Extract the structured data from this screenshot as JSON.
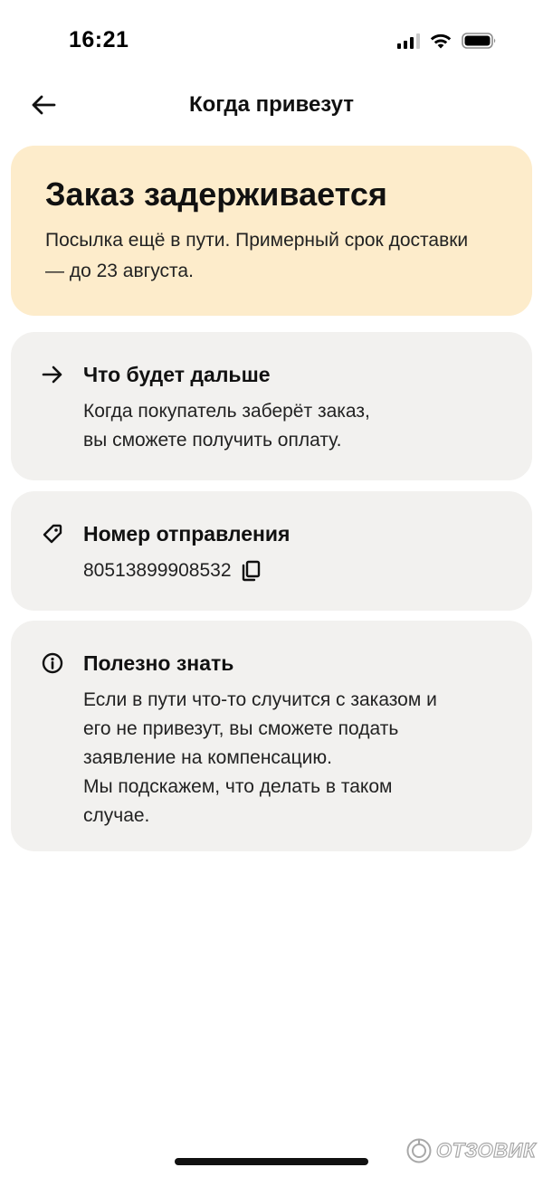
{
  "status_bar": {
    "time": "16:21",
    "icons": [
      "cellular-signal-icon",
      "wifi-icon",
      "battery-icon"
    ]
  },
  "header": {
    "title": "Когда привезут",
    "back_icon": "arrow-left-icon"
  },
  "alert": {
    "title": "Заказ задерживается",
    "text": "Посылка ещё в пути. Примерный срок доставки — до 23 августа.",
    "background_color": "#fdeccb"
  },
  "cards": {
    "next": {
      "icon": "arrow-right-icon",
      "title": "Что будет дальше",
      "lines": [
        "Когда покупатель заберёт заказ,",
        "вы сможете получить оплату."
      ]
    },
    "tracking": {
      "icon": "tag-icon",
      "title": "Номер отправления",
      "number": "80513899908532",
      "copy_icon": "copy-icon"
    },
    "useful": {
      "icon": "info-icon",
      "title": "Полезно знать",
      "lines": [
        "Если в пути что-то случится с заказом и",
        "его не привезут, вы сможете подать",
        "заявление на компенсацию.",
        "Мы подскажем, что делать в таком",
        "случае."
      ]
    },
    "background_color": "#f2f1ef"
  },
  "watermark": {
    "text": "ОТЗОВИК",
    "icon": "otzovik-logo-icon"
  }
}
